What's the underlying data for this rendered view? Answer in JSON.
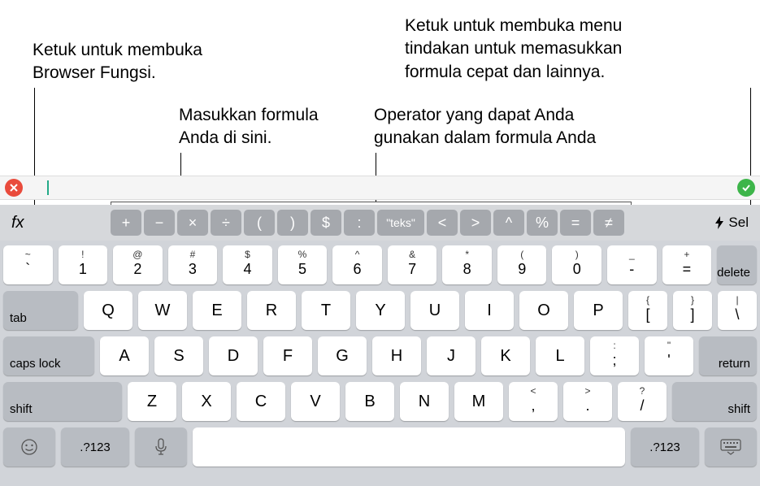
{
  "callouts": {
    "fx": "Ketuk untuk membuka Browser Fungsi.",
    "formula": "Masukkan formula Anda di sini.",
    "operators": "Operator yang dapat Anda gunakan dalam formula Anda",
    "menu": "Ketuk untuk membuka menu tindakan untuk memasukkan formula cepat dan lainnya."
  },
  "formula_bar": {
    "fx_label": "fx",
    "sel_label": "Sel"
  },
  "operators": [
    "+",
    "−",
    "×",
    "÷",
    "(",
    ")",
    "$",
    ":",
    "\"teks\"",
    "<",
    ">",
    "^",
    "%",
    "=",
    "≠"
  ],
  "keyboard": {
    "row1": [
      {
        "u": "~",
        "l": "`"
      },
      {
        "u": "!",
        "l": "1"
      },
      {
        "u": "@",
        "l": "2"
      },
      {
        "u": "#",
        "l": "3"
      },
      {
        "u": "$",
        "l": "4"
      },
      {
        "u": "%",
        "l": "5"
      },
      {
        "u": "^",
        "l": "6"
      },
      {
        "u": "&",
        "l": "7"
      },
      {
        "u": "*",
        "l": "8"
      },
      {
        "u": "(",
        "l": "9"
      },
      {
        "u": ")",
        "l": "0"
      },
      {
        "u": "_",
        "l": "-"
      },
      {
        "u": "+",
        "l": "="
      }
    ],
    "delete": "delete",
    "tab": "tab",
    "row2": [
      "Q",
      "W",
      "E",
      "R",
      "T",
      "Y",
      "U",
      "I",
      "O",
      "P"
    ],
    "row2_brackets": [
      {
        "u": "{",
        "l": "["
      },
      {
        "u": "}",
        "l": "]"
      },
      {
        "u": "|",
        "l": "\\"
      }
    ],
    "caps": "caps lock",
    "row3": [
      "A",
      "S",
      "D",
      "F",
      "G",
      "H",
      "J",
      "K",
      "L"
    ],
    "row3_punct": [
      {
        "u": ":",
        "l": ";"
      },
      {
        "u": "\"",
        "l": "'"
      }
    ],
    "return": "return",
    "shift": "shift",
    "row4": [
      "Z",
      "X",
      "C",
      "V",
      "B",
      "N",
      "M"
    ],
    "row4_punct": [
      {
        "u": "<",
        "l": ","
      },
      {
        "u": ">",
        "l": "."
      },
      {
        "u": "?",
        "l": "/"
      }
    ],
    "num_label": ".?123"
  }
}
